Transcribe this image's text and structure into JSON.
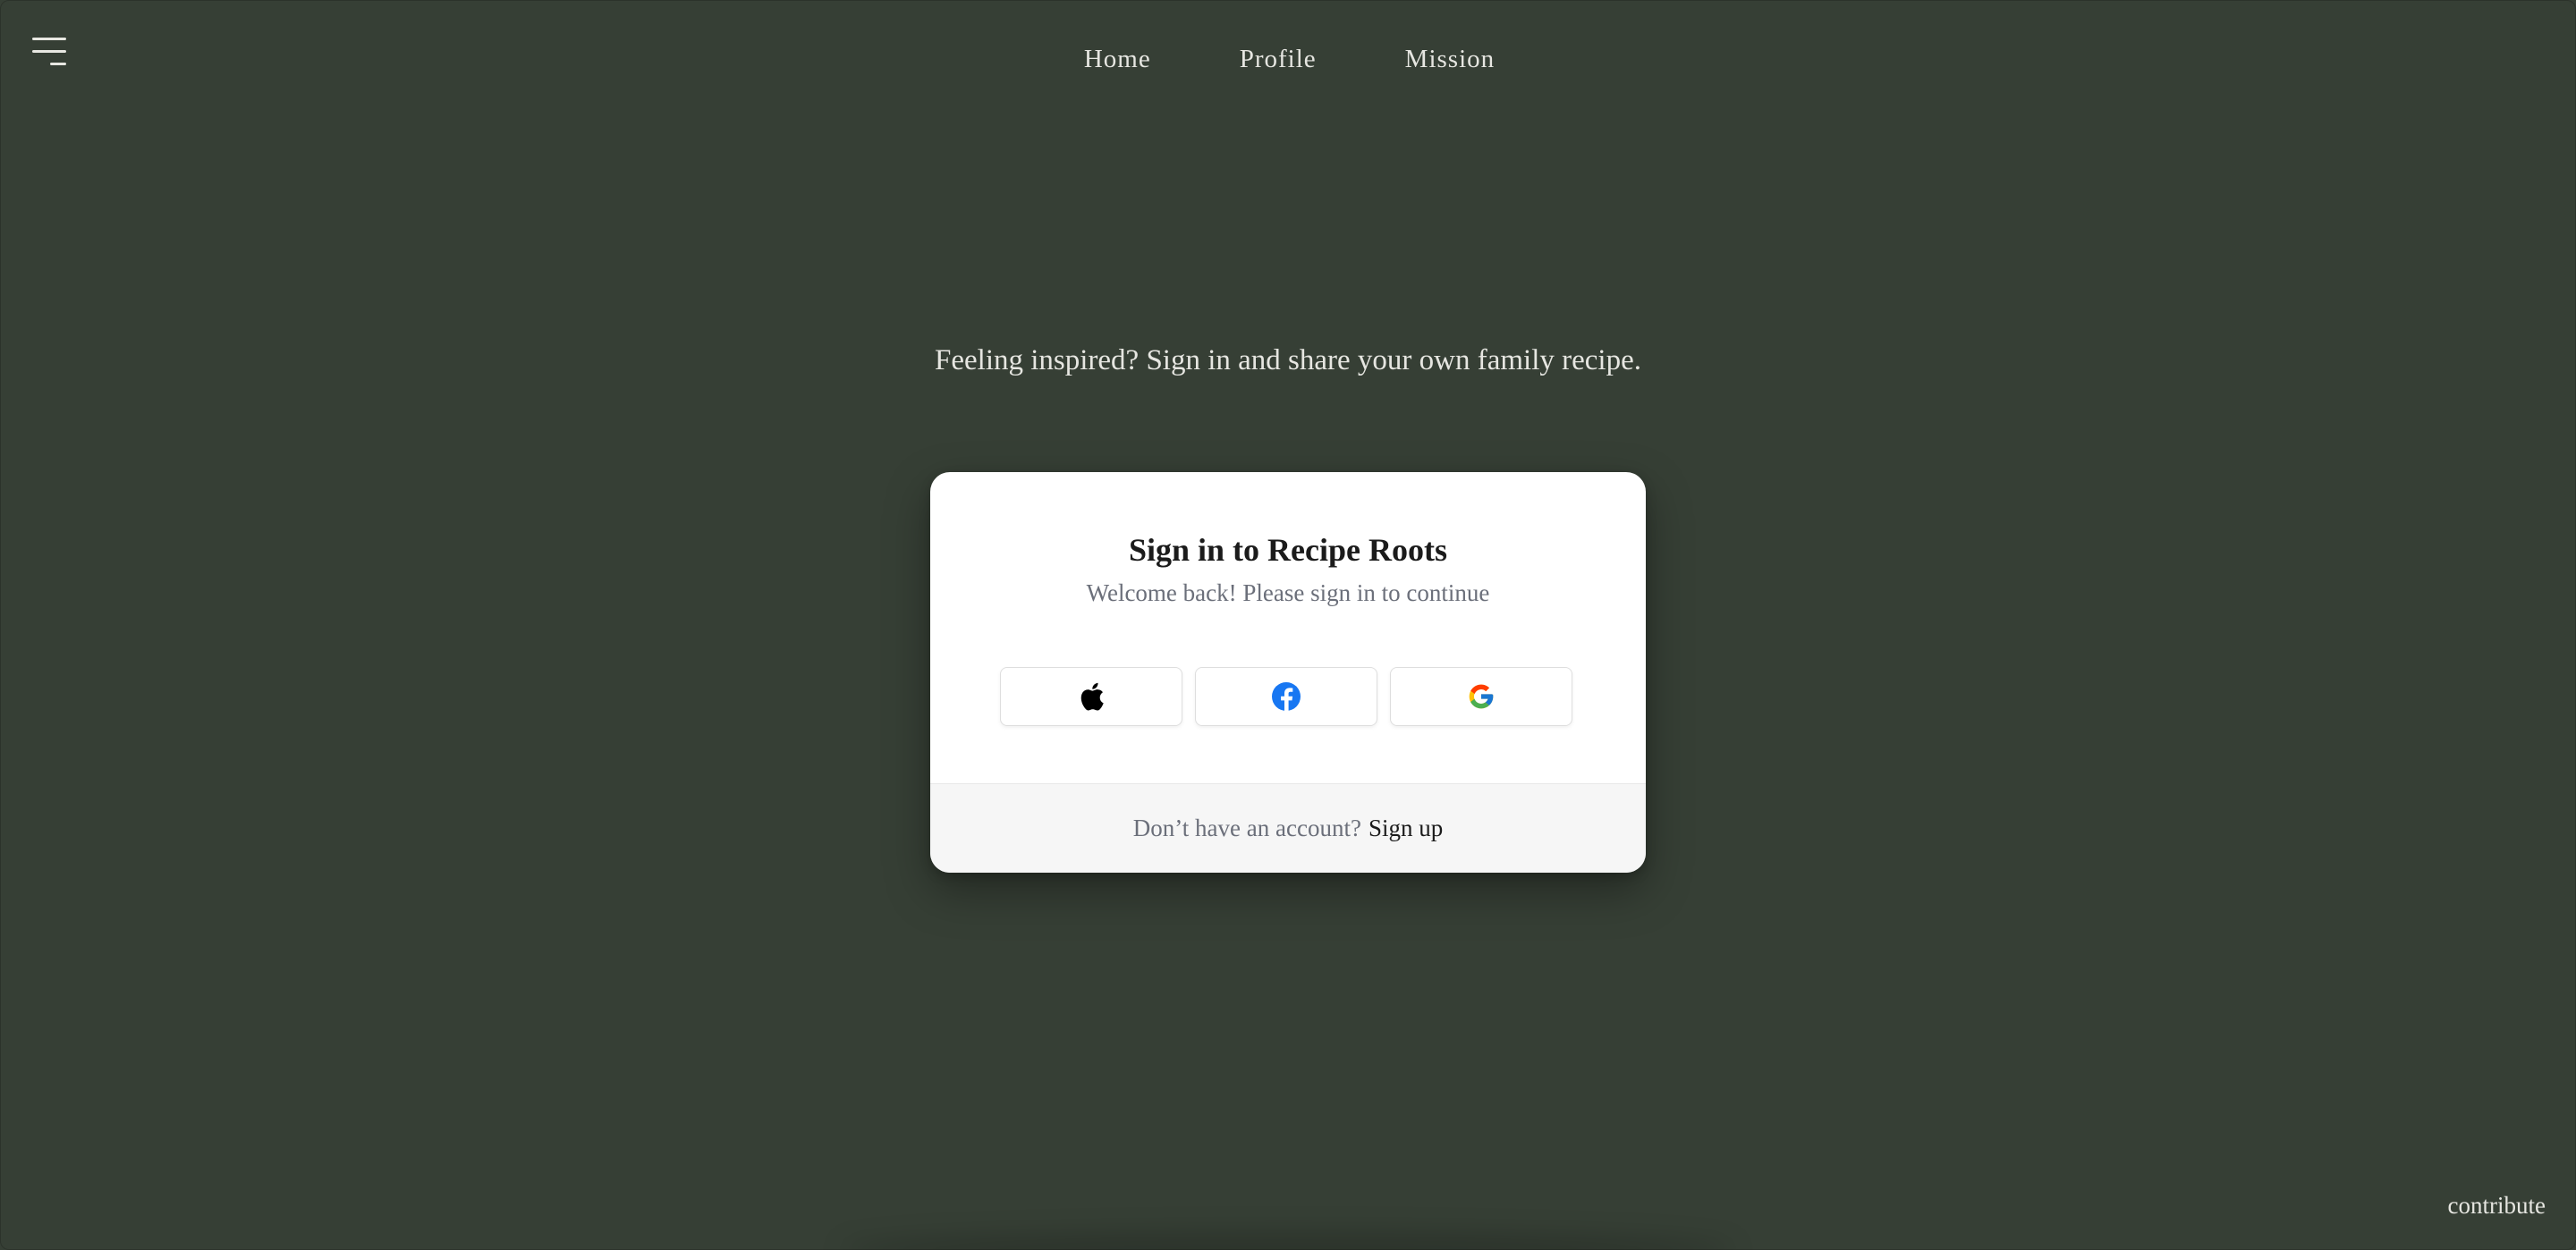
{
  "nav": {
    "menu_icon": "hamburger-menu-icon",
    "links": [
      {
        "label": "Home"
      },
      {
        "label": "Profile"
      },
      {
        "label": "Mission"
      }
    ]
  },
  "tagline": "Feeling inspired? Sign in and share your own family recipe.",
  "signin": {
    "title": "Sign in to Recipe Roots",
    "subtitle": "Welcome back! Please sign in to continue",
    "providers": [
      {
        "name": "apple-icon"
      },
      {
        "name": "facebook-icon"
      },
      {
        "name": "google-icon"
      }
    ],
    "footer_prompt": "Don’t have an account?",
    "footer_link": "Sign up"
  },
  "contribute": "contribute",
  "colors": {
    "background": "#363f35",
    "card": "#ffffff",
    "card_footer": "#f6f6f6",
    "facebook_blue": "#1877f2"
  }
}
